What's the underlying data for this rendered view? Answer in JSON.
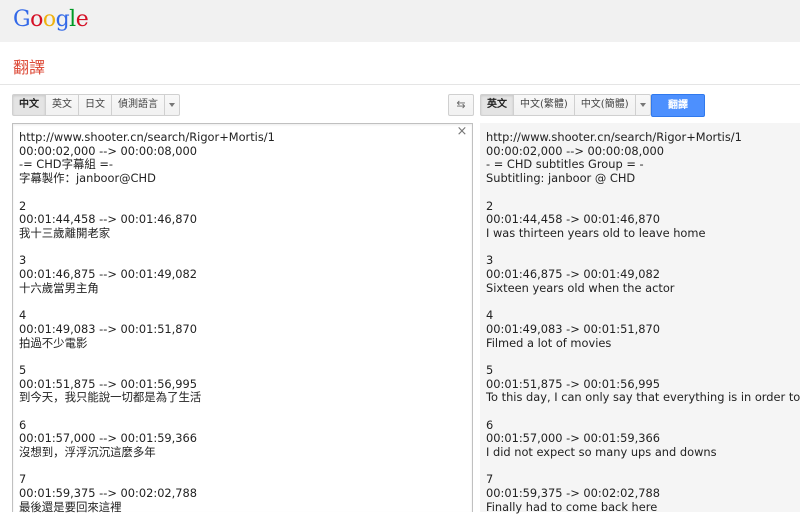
{
  "logo": {
    "letters": [
      "G",
      "o",
      "o",
      "g",
      "l",
      "e"
    ],
    "colors": [
      "#3369e8",
      "#d50f25",
      "#eeb211",
      "#3369e8",
      "#009925",
      "#d50f25"
    ]
  },
  "app_title": "翻譯",
  "source_langs": [
    {
      "label": "中文",
      "selected": true
    },
    {
      "label": "英文",
      "selected": false
    },
    {
      "label": "日文",
      "selected": false
    },
    {
      "label": "偵測語言",
      "selected": false
    }
  ],
  "target_langs": [
    {
      "label": "英文",
      "selected": true
    },
    {
      "label": "中文(繁體)",
      "selected": false
    },
    {
      "label": "中文(簡體)",
      "selected": false
    }
  ],
  "translate_button": "翻譯",
  "source_lines": [
    [
      "http://www.shooter.cn/search/Rigor+Mortis/1",
      "00:00:02,000 --> 00:00:08,000",
      "-= CHD字幕組 =-",
      "字幕製作：janboor@CHD"
    ],
    [
      "2",
      "00:01:44,458 --> 00:01:46,870",
      "我十三歲離開老家"
    ],
    [
      "3",
      "00:01:46,875 --> 00:01:49,082",
      "十六歲當男主角"
    ],
    [
      "4",
      "00:01:49,083 --> 00:01:51,870",
      "拍過不少電影"
    ],
    [
      "5",
      "00:01:51,875 --> 00:01:56,995",
      "到今天，我只能說一切都是為了生活"
    ],
    [
      "6",
      "00:01:57,000 --> 00:01:59,366",
      "沒想到，浮浮沉沉這麼多年"
    ],
    [
      "7",
      "00:01:59,375 --> 00:02:02,788",
      "最後還是要回來這裡"
    ]
  ],
  "target_lines": [
    [
      "http://www.shooter.cn/search/Rigor+Mortis/1",
      "00:00:02,000 --> 00:00:08,000",
      "- = CHD subtitles Group = -",
      "Subtitling: janboor @ CHD"
    ],
    [
      "2",
      "00:01:44,458 -> 00:01:46,870",
      "I was thirteen years old to leave home"
    ],
    [
      "3",
      "00:01:46,875 -> 00:01:49,082",
      "Sixteen years old when the actor"
    ],
    [
      "4",
      "00:01:49,083 -> 00:01:51,870",
      "Filmed a lot of movies"
    ],
    [
      "5",
      "00:01:51,875 -> 00:01:56,995",
      "To this day, I can only say that everything is in order to live"
    ],
    [
      "6",
      "00:01:57,000 -> 00:01:59,366",
      "I did not expect so many ups and downs"
    ],
    [
      "7",
      "00:01:59,375 -> 00:02:02,788",
      "Finally had to come back here"
    ]
  ]
}
